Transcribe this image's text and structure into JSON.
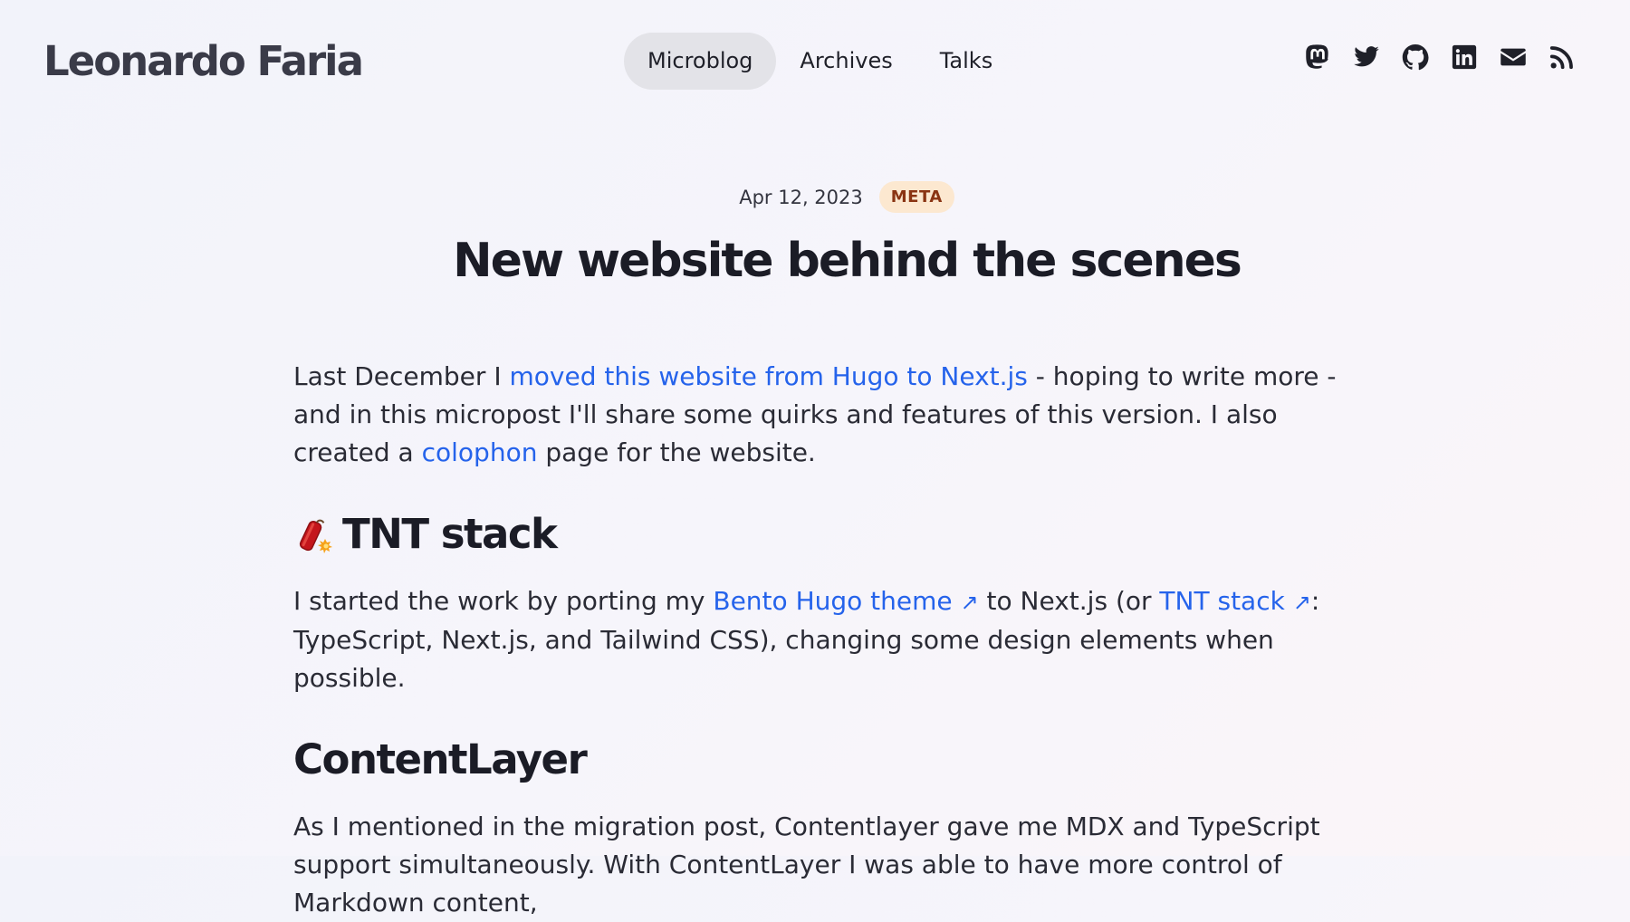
{
  "header": {
    "site_title": "Leonardo Faria",
    "nav": [
      {
        "label": "Microblog",
        "active": true
      },
      {
        "label": "Archives",
        "active": false
      },
      {
        "label": "Talks",
        "active": false
      }
    ],
    "social_icons": [
      "mastodon-icon",
      "twitter-icon",
      "github-icon",
      "linkedin-icon",
      "email-icon",
      "rss-icon"
    ]
  },
  "post": {
    "date": "Apr 12, 2023",
    "tag": "META",
    "title": "New website behind the scenes",
    "intro": {
      "text1": "Last December I ",
      "link1": "moved this website from Hugo to Next.js",
      "text2": " - hoping to write more - and in this micropost I'll share some quirks and features of this version. I also created a ",
      "link2": "colophon",
      "text3": " page for the website."
    },
    "section_tnt": {
      "emoji": "🧨",
      "heading": "TNT stack",
      "text1": "I started the work by porting my ",
      "link1": "Bento Hugo theme",
      "text2": " to Next.js (or ",
      "link2": "TNT stack",
      "text3": ": TypeScript, Next.js, and Tailwind CSS), changing some design elements when possible."
    },
    "section_contentlayer": {
      "heading": "ContentLayer",
      "text": "As I mentioned in the migration post, Contentlayer gave me MDX and TypeScript support simultaneously. With ContentLayer I was able to have more control of Markdown content,"
    }
  },
  "colors": {
    "link": "#2563eb",
    "tag_bg": "#fce8d0",
    "tag_text": "#8a3413",
    "nav_active_bg": "#e3e3e8"
  }
}
